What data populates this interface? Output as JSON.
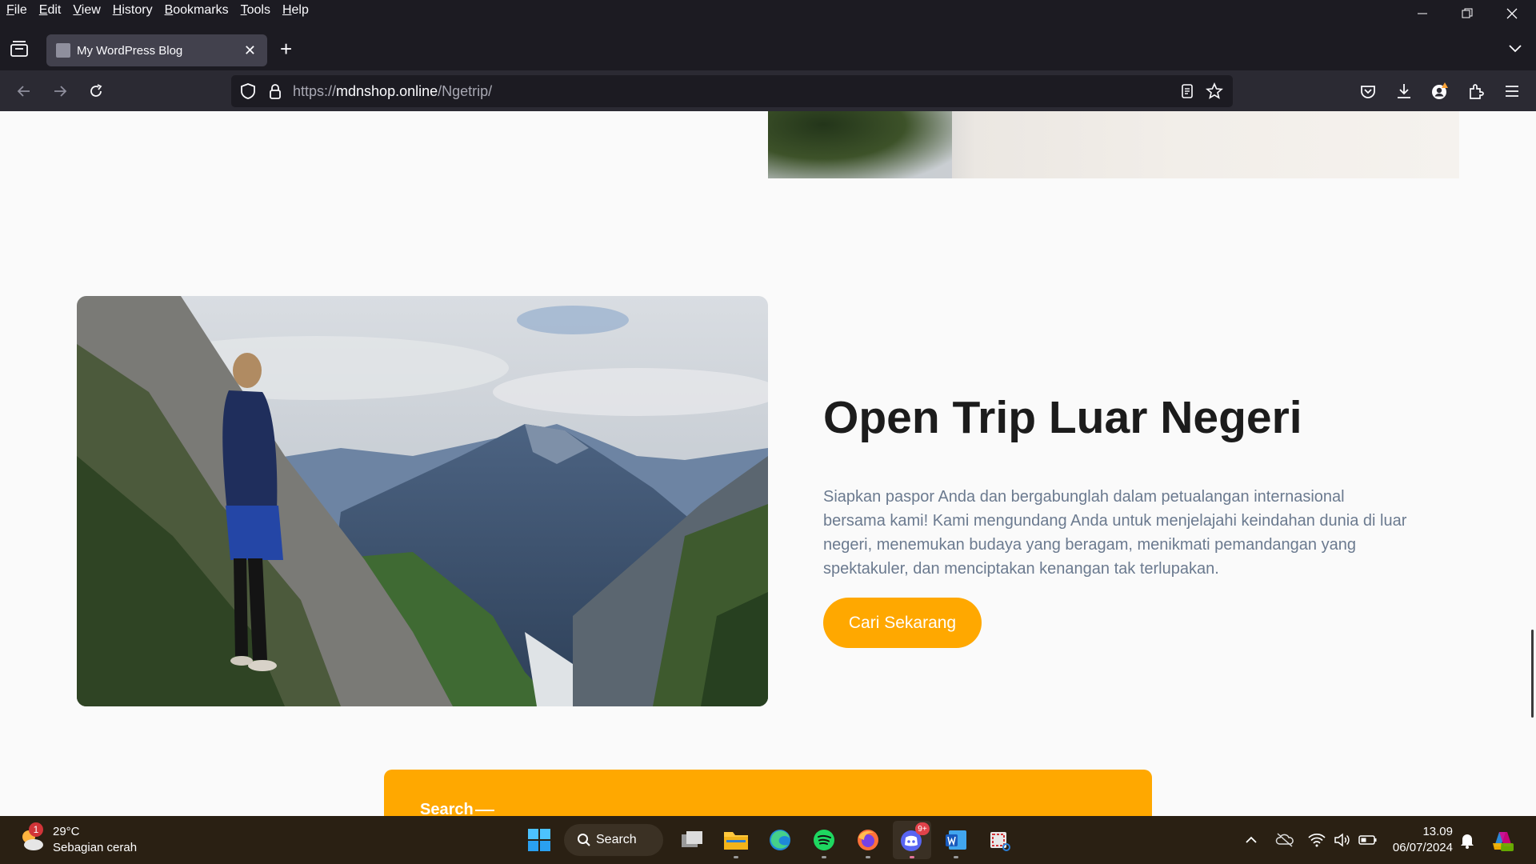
{
  "browser": {
    "menu": [
      "File",
      "Edit",
      "View",
      "History",
      "Bookmarks",
      "Tools",
      "Help"
    ],
    "tab_title": "My WordPress Blog",
    "url_prefix": "https://",
    "url_domain": "mdnshop.online",
    "url_path": "/Ngetrip/"
  },
  "page": {
    "hero_title": "Open Trip Luar Negeri",
    "hero_description": "Siapkan paspor Anda dan bergabunglah dalam petualangan internasional bersama kami! Kami mengundang Anda untuk menjelajahi keindahan dunia di luar negeri, menemukan budaya yang beragam, menikmati pemandangan yang spektakuler, dan menciptakan kenangan tak terlupakan.",
    "cta_label": "Cari Sekarang",
    "search_heading": "Search",
    "accent_color": "#ffa800"
  },
  "taskbar": {
    "weather_temp": "29°C",
    "weather_desc": "Sebagian cerah",
    "weather_badge": "1",
    "search_label": "Search",
    "discord_badge": "9+",
    "time": "13.09",
    "date": "06/07/2024",
    "apps": [
      "task-view",
      "file-explorer",
      "edge",
      "spotify",
      "firefox",
      "discord",
      "word",
      "snipping-tool"
    ]
  }
}
